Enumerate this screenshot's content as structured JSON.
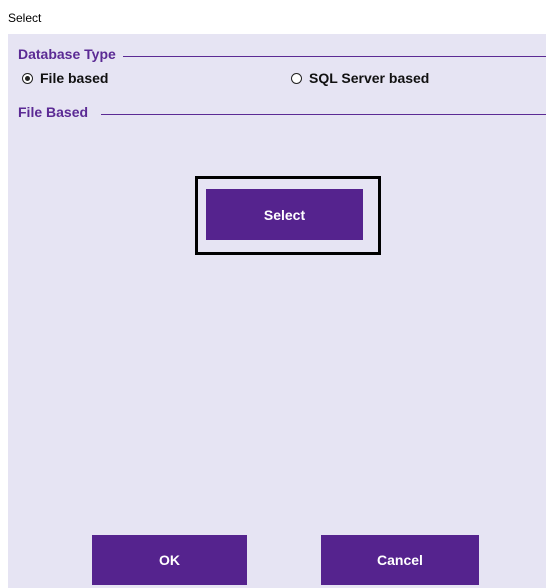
{
  "window": {
    "title": "Select"
  },
  "database_type": {
    "group_label": "Database Type",
    "options": [
      {
        "label": "File based",
        "checked": true
      },
      {
        "label": "SQL Server based",
        "checked": false
      }
    ]
  },
  "file_based": {
    "group_label": "File Based",
    "select_label": "Select"
  },
  "footer": {
    "ok_label": "OK",
    "cancel_label": "Cancel"
  },
  "colors": {
    "accent": "#55238e",
    "group_text": "#5b2a94",
    "panel_background": "#e6e4f3"
  }
}
